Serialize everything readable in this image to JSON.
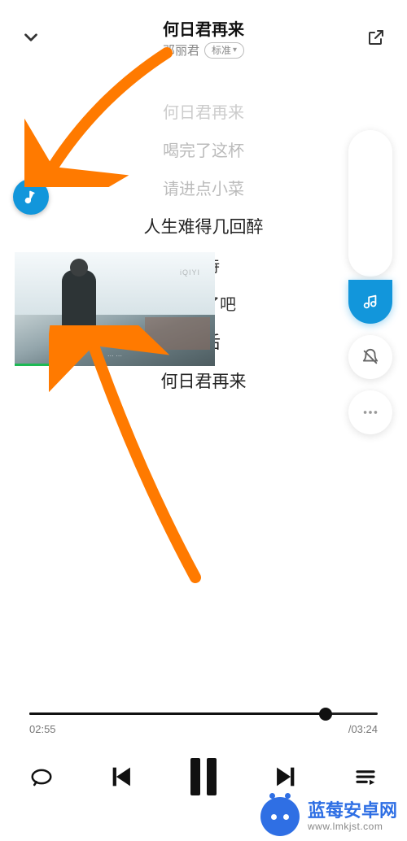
{
  "header": {
    "song_title": "何日君再来",
    "artist": "邓丽君",
    "quality_label": "标准"
  },
  "lyrics": [
    {
      "text": "何日君再来",
      "cls": "dim"
    },
    {
      "text": "喝完了这杯",
      "cls": ""
    },
    {
      "text": "请进点小菜",
      "cls": ""
    },
    {
      "text": "人生难得几回醉",
      "cls": "active"
    },
    {
      "text": "可待",
      "cls": "near"
    },
    {
      "text": "不干了吧",
      "cls": "near"
    },
    {
      "text": "别后",
      "cls": "active"
    },
    {
      "text": "何日君再来",
      "cls": "active"
    }
  ],
  "mv": {
    "logo": "iQIYI",
    "subtitle": "··· ···"
  },
  "player": {
    "current_time": "02:55",
    "total_time": "/03:24",
    "progress_pct": 85
  },
  "watermark": {
    "brand": "蓝莓安卓网",
    "url": "www.lmkjst.com"
  },
  "colors": {
    "brand_blue": "#1296db",
    "arrow": "#ff7a00",
    "wm_blue": "#2f6fe4"
  }
}
